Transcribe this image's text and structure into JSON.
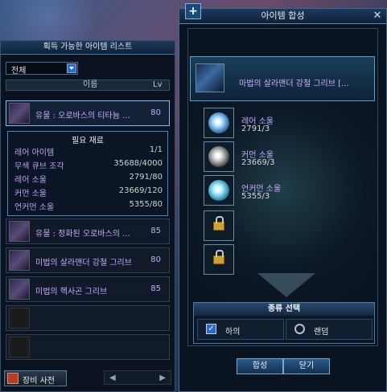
{
  "left_panel": {
    "title": "획득 가능한 아이템 리스트",
    "filter_value": "전체",
    "col_name": "이름",
    "col_lv": "Lv",
    "items": [
      {
        "name": "유물 : 오로바스의 티타늄 ...",
        "lv": "80"
      },
      {
        "name": "유물 : 정화된 오로바스의 ...",
        "lv": "85"
      },
      {
        "name": "미법의 살라맨더 강철 그리브",
        "lv": "80"
      },
      {
        "name": "미법의 헥사곤 그리브",
        "lv": "85"
      }
    ],
    "materials": {
      "title": "필요 재료",
      "rows": [
        {
          "name": "레어 아이템",
          "val": "1/1"
        },
        {
          "name": "무색 큐브 조각",
          "val": "35688/4000"
        },
        {
          "name": "레어 소울",
          "val": "2791/80"
        },
        {
          "name": "커먼 소울",
          "val": "23669/120"
        },
        {
          "name": "언커먼 소울",
          "val": "5355/80"
        }
      ]
    },
    "dict_button": "장비 사전",
    "pager_prev": "◀",
    "pager_next": "▶"
  },
  "right_panel": {
    "plus": "+",
    "title": "아이템 합성",
    "close": "✕",
    "target_name": "마법의 살라맨더 강철 그리브 [...",
    "materials": [
      {
        "name": "레어 소울",
        "count": "2791/3"
      },
      {
        "name": "커먼 소울",
        "count": "23669/3"
      },
      {
        "name": "언커먼 소울",
        "count": "5355/3"
      }
    ],
    "type_title": "종류 선택",
    "opt_low": "하의",
    "opt_random": "랜덤",
    "btn_combine": "합성",
    "btn_close": "닫기"
  }
}
